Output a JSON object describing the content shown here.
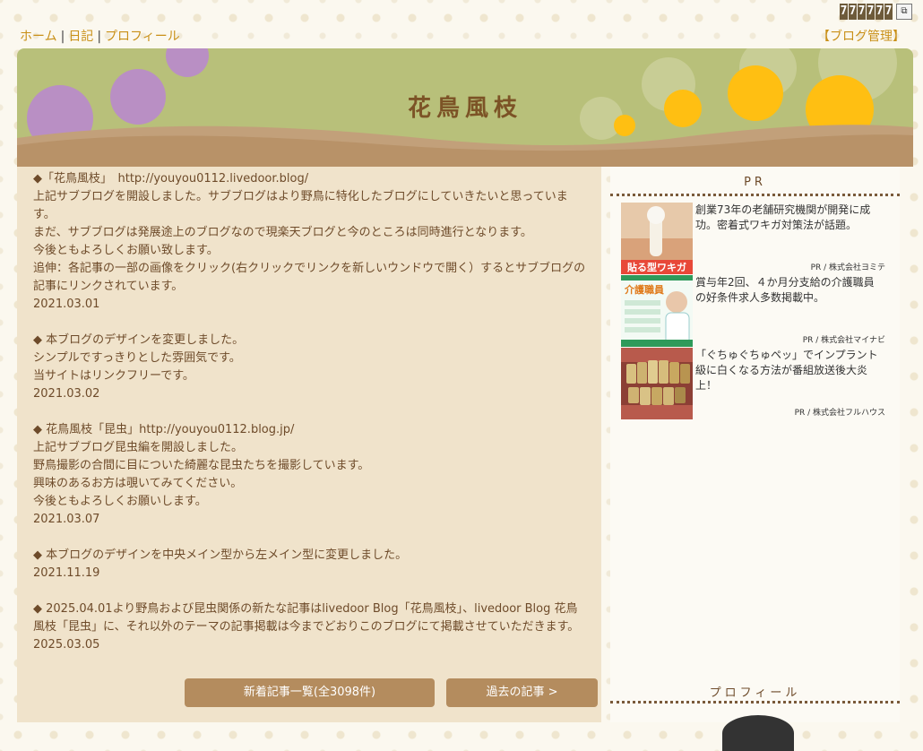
{
  "nav": {
    "home": "ホーム",
    "diary": "日記",
    "profile": "プロフィール",
    "separator": "|",
    "admin": "【ブログ管理】"
  },
  "counter": {
    "digits": [
      "7",
      "7",
      "7",
      "7",
      "7",
      "7"
    ]
  },
  "header": {
    "title": "花鳥風枝"
  },
  "posts": [
    {
      "lines": [
        "◆「花鳥風枝」　http://youyou0112.livedoor.blog/",
        "上記サブブログを開設しました。サブブログはより野鳥に特化したブログにしていきたいと思っています。",
        "まだ、サブブログは発展途上のブログなので現楽天ブログと今のところは同時進行となります。",
        "今後ともよろしくお願い致します。",
        "追伸：各記事の一部の画像をクリック(右クリックでリンクを新しいウンドウで開く）するとサブブログの記事にリンクされています。"
      ],
      "date": "2021.03.01"
    },
    {
      "lines": [
        "◆ 本ブログのデザインを変更しました。",
        "シンプルですっきりとした雰囲気です。",
        "当サイトはリンクフリーです。"
      ],
      "date": "2021.03.02"
    },
    {
      "lines": [
        "◆ 花鳥風枝「昆虫」http://youyou0112.blog.jp/",
        "上記サブブログ昆虫編を開設しました。",
        "野鳥撮影の合間に目についた綺麗な昆虫たちを撮影しています。",
        "興味のあるお方は覗いてみてください。",
        "今後ともよろしくお願いします。"
      ],
      "date": "2021.03.07"
    },
    {
      "lines": [
        "◆ 本ブログのデザインを中央メイン型から左メイン型に変更しました。"
      ],
      "date": "2021.11.19"
    },
    {
      "lines": [
        "◆ 2025.04.01より野鳥および昆虫関係の新たな記事はlivedoor Blog「花鳥風枝」、livedoor Blog 花鳥風枝「昆虫」に、それ以外のテーマの記事掲載は今までどおりこのブログにて掲載させていただきます。"
      ],
      "date": "2025.03.05"
    }
  ],
  "buttons": {
    "list": "新着記事一覧(全3098件)",
    "past": "過去の記事 >"
  },
  "side": {
    "pr_title": "PR",
    "ads": [
      {
        "text": "創業73年の老舗研究機関が開発に成功。密着式ワキガ対策法が話題。",
        "sponsor": "PR / 株式会社ヨミテ",
        "thumb_label": "貼る型ワキガ"
      },
      {
        "text": "賞与年2回、４か月分支給の介護職員の好条件求人多数掲載中。",
        "sponsor": "PR / 株式会社マイナビ",
        "thumb_label": "介護職員"
      },
      {
        "text": "「ぐちゅぐちゅペッ」でインプラント級に白くなる方法が番組放送後大炎上！",
        "sponsor": "PR / 株式会社フルハウス",
        "thumb_label": ""
      }
    ],
    "profile_title": "プロフィール"
  }
}
